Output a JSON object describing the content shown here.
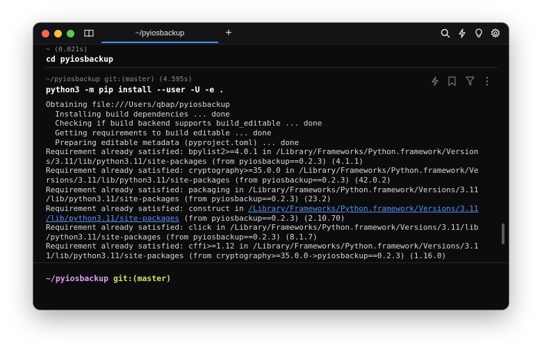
{
  "tab": {
    "title": "~/pyiosbackup",
    "add_label": "+"
  },
  "colors": {
    "accent": "#4f8ef0",
    "prompt_path": "#e29ef0",
    "prompt_git": "#c8e27a",
    "link": "#5b8ff0"
  },
  "icons": {
    "titlebar_left": "book-icon",
    "titlebar_right": [
      "search-icon",
      "bolt-icon",
      "lightbulb-icon",
      "gear-icon"
    ],
    "block_actions": [
      "bolt-icon",
      "bookmark-icon",
      "filter-icon",
      "more-vertical-icon"
    ]
  },
  "block1": {
    "meta": "~ (0.021s)",
    "command": "cd pyiosbackup"
  },
  "block2": {
    "meta": "~/pyiosbackup git:(master) (4.595s)",
    "command": "python3 -m pip install --user -U -e .",
    "output": [
      "Obtaining file:///Users/qbap/pyiosbackup",
      "  Installing build dependencies ... done",
      "  Checking if build backend supports build_editable ... done",
      "  Getting requirements to build editable ... done",
      "  Preparing editable metadata (pyproject.toml) ... done",
      "Requirement already satisfied: bpylist2>=4.0.1 in /Library/Frameworks/Python.framework/Version",
      "s/3.11/lib/python3.11/site-packages (from pyiosbackup==0.2.3) (4.1.1)",
      "Requirement already satisfied: cryptography>=35.0.0 in /Library/Frameworks/Python.framework/Ve",
      "rsions/3.11/lib/python3.11/site-packages (from pyiosbackup==0.2.3) (42.0.2)",
      "Requirement already satisfied: packaging in /Library/Frameworks/Python.framework/Versions/3.11",
      "/lib/python3.11/site-packages (from pyiosbackup==0.2.3) (23.2)"
    ],
    "construct": {
      "prefix": "Requirement already satisfied: construct in ",
      "link1": "/Library/Frameworks/Python.framework/Versions/3.11",
      "link2": "/lib/python3.11/site-packages",
      "suffix": " (from pyiosbackup==0.2.3) (2.10.70)"
    },
    "output_after": [
      "Requirement already satisfied: click in /Library/Frameworks/Python.framework/Versions/3.11/lib",
      "/python3.11/site-packages (from pyiosbackup==0.2.3) (8.1.7)",
      "Requirement already satisfied: cffi>=1.12 in /Library/Frameworks/Python.framework/Versions/3.1",
      "1/lib/python3.11/site-packages (from cryptography>=35.0.0->pyiosbackup==0.2.3) (1.16.0)"
    ]
  },
  "prompt": {
    "path": "~/pyiosbackup",
    "git": "git:(master)"
  }
}
